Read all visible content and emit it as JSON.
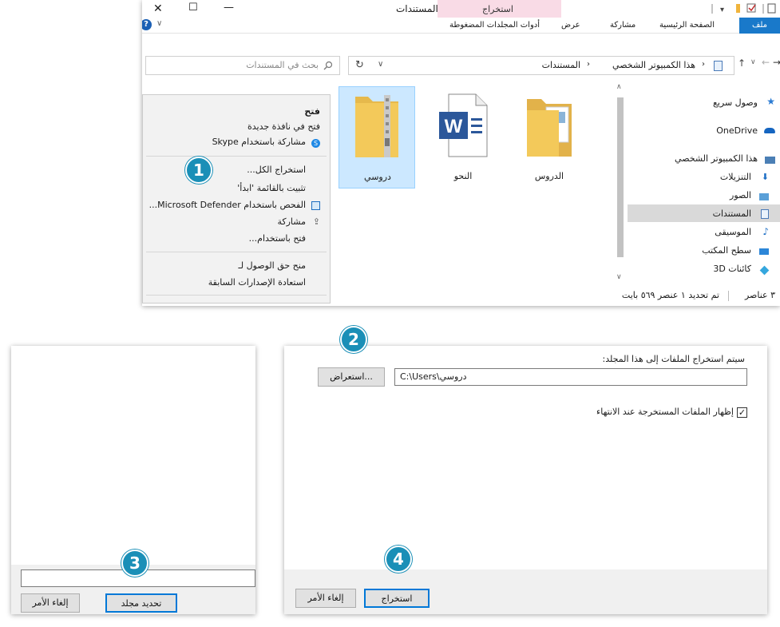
{
  "explorer": {
    "window_title": "المستندات",
    "window_controls": {
      "close": "✕",
      "maximize": "☐",
      "minimize": "—"
    },
    "contextual_tab_group": "استخراج",
    "contextual_tab": "أدوات المجلدات المضغوطة",
    "ribbon_tabs": [
      "ملف",
      "الصفحة الرئيسية",
      "مشاركة",
      "عرض"
    ],
    "help": "?",
    "breadcrumb": [
      "هذا الكمبيوتر الشخصي",
      "المستندات"
    ],
    "search_placeholder": "بحث في المستندات",
    "nav_items": [
      "وصول سريع",
      "OneDrive",
      "هذا الكمبيوتر الشخصي",
      "التنزيلات",
      "الصور",
      "المستندات",
      "الموسيقى",
      "سطح المكتب",
      "كائنات ‎3D"
    ],
    "files": [
      {
        "name": "الدروس",
        "type": "folder"
      },
      {
        "name": "النحو",
        "type": "word"
      },
      {
        "name": "دروسي",
        "type": "zip"
      }
    ],
    "status_items": "٣ عناصر",
    "status_selected": "تم تحديد ١ عنصر ٥٦٩ بايت"
  },
  "context_menu": {
    "items": [
      "فتح",
      "فتح في نافذة جديدة",
      "مشاركة باستخدام Skype",
      "استخراج الكل...",
      "تثبيت بالقائمة 'ابدأ'",
      "الفحص باستخدام Microsoft Defender...",
      "مشاركة",
      "فتح باستخدام...",
      "منح حق الوصول لـ",
      "استعادة الإصدارات السابقة"
    ]
  },
  "extract_dialog": {
    "prompt": "سيتم استخراج الملفات إلى هذا المجلد:",
    "path_value": "C:\\Users\\دروسي",
    "browse_button": "استعراض...",
    "checkbox_label": "إظهار الملفات المستخرجة عند الانتهاء",
    "checkbox_checked": true,
    "extract_button": "استخراج",
    "cancel_button": "إلغاء الأمر"
  },
  "folder_dialog": {
    "select_button": "تحديد مجلد",
    "cancel_button": "إلغاء الأمر"
  },
  "steps": [
    "1",
    "2",
    "3",
    "4"
  ],
  "colors": {
    "accent": "#0078d7",
    "badge": "#1a8fb7",
    "contextual_tab": "#f9dbe6",
    "selection": "#cce8ff",
    "folder": "#f3c95a",
    "word": "#2b579a"
  }
}
